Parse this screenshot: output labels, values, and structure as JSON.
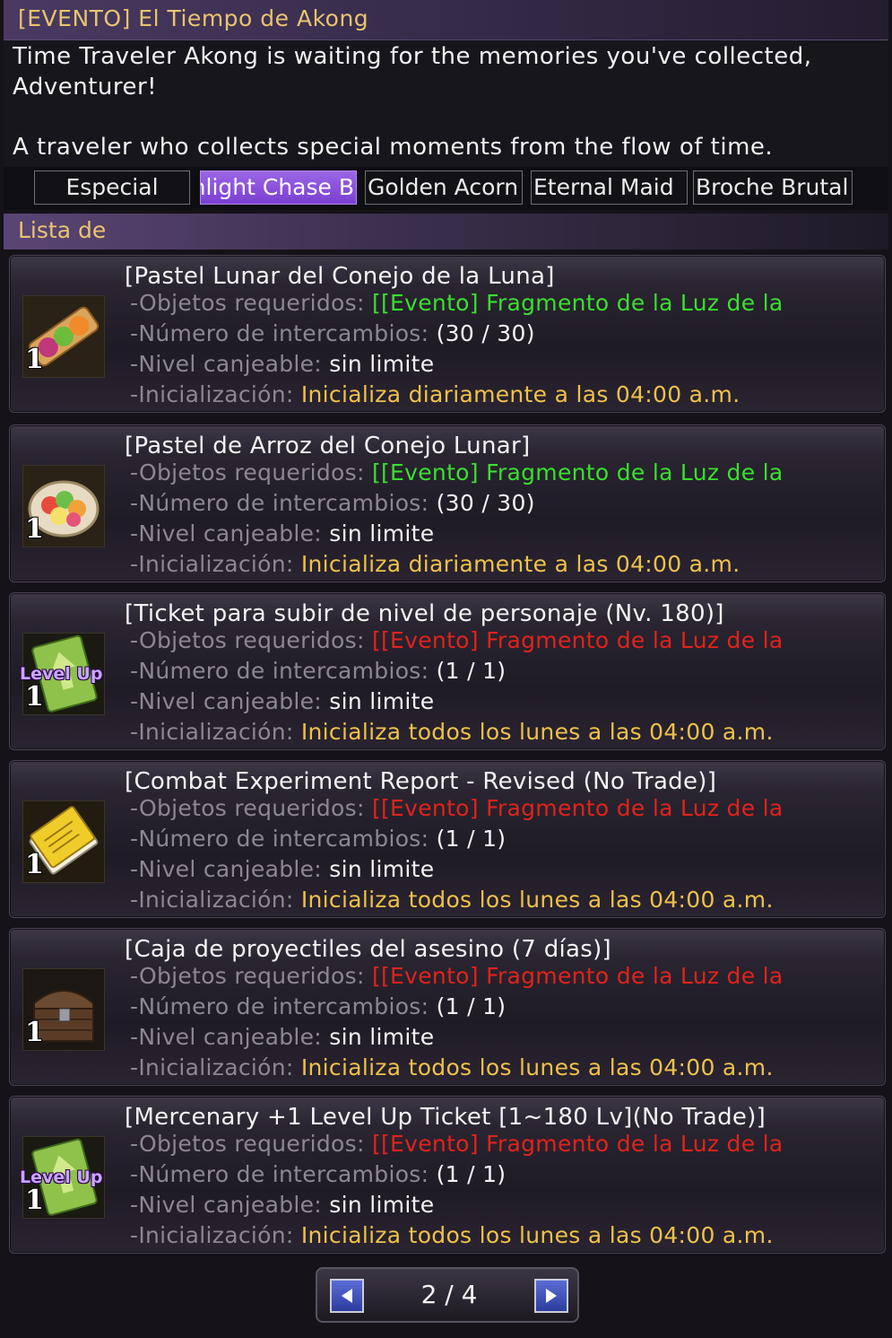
{
  "window": {
    "title": "[EVENTO] El Tiempo de Akong"
  },
  "intro": {
    "line1": "Time Traveler Akong is waiting for the memories you've collected,",
    "line2": "Adventurer!",
    "line3": "A traveler who collects special moments from the flow of time."
  },
  "tabs": [
    {
      "label": "Especial",
      "active": false
    },
    {
      "label": "Moonlight Chase B",
      "active": true
    },
    {
      "label": "Golden Acorn",
      "active": false
    },
    {
      "label": "Eternal Maid",
      "active": false
    },
    {
      "label": "Broche Brutal",
      "active": false
    }
  ],
  "section": {
    "label": "Lista de"
  },
  "labels": {
    "required": "-Objetos requeridos:",
    "exchanges": "-Número de intercambios:",
    "level": "-Nivel canjeable:",
    "reset": "-Inicialización:"
  },
  "items": [
    {
      "name": "[Pastel Lunar del Conejo de la Luna]",
      "required": "[[Evento] Fragmento de la Luz de la",
      "required_status": "green",
      "exchanges": "(30 / 30)",
      "level": "sin limite",
      "reset": "Inicializa diariamente a las 04:00 a.m.",
      "count": "1",
      "icon": "mooncake-plate-icon"
    },
    {
      "name": "[Pastel de Arroz del Conejo Lunar]",
      "required": "[[Evento] Fragmento de la Luz de la",
      "required_status": "green",
      "exchanges": "(30 / 30)",
      "level": "sin limite",
      "reset": "Inicializa diariamente a las 04:00 a.m.",
      "count": "1",
      "icon": "rice-cake-bowl-icon"
    },
    {
      "name": "[Ticket para subir de nivel de personaje (Nv. 180)]",
      "required": "[[Evento] Fragmento de la Luz de la",
      "required_status": "red",
      "exchanges": "(1 / 1)",
      "level": "sin limite",
      "reset": "Inicializa todos los lunes a las 04:00 a.m.",
      "count": "1",
      "icon": "level-up-ticket-icon",
      "badge": "Level Up"
    },
    {
      "name": "[Combat Experiment Report - Revised (No Trade)]",
      "required": "[[Evento] Fragmento de la Luz de la",
      "required_status": "red",
      "exchanges": "(1 / 1)",
      "level": "sin limite",
      "reset": "Inicializa todos los lunes a las 04:00 a.m.",
      "count": "1",
      "icon": "report-book-icon"
    },
    {
      "name": "[Caja de proyectiles del asesino (7 días)]",
      "required": "[[Evento] Fragmento de la Luz de la",
      "required_status": "red",
      "exchanges": "(1 / 1)",
      "level": "sin limite",
      "reset": "Inicializa todos los lunes a las 04:00 a.m.",
      "count": "1",
      "icon": "treasure-chest-icon"
    },
    {
      "name": "[Mercenary +1 Level Up Ticket [1~180 Lv](No Trade)]",
      "required": "[[Evento] Fragmento de la Luz de la",
      "required_status": "red",
      "exchanges": "(1 / 1)",
      "level": "sin limite",
      "reset": "Inicializa todos los lunes a las 04:00 a.m.",
      "count": "1",
      "icon": "level-up-ticket-icon",
      "badge": "Level Up"
    }
  ],
  "pager": {
    "page": "2 / 4"
  }
}
